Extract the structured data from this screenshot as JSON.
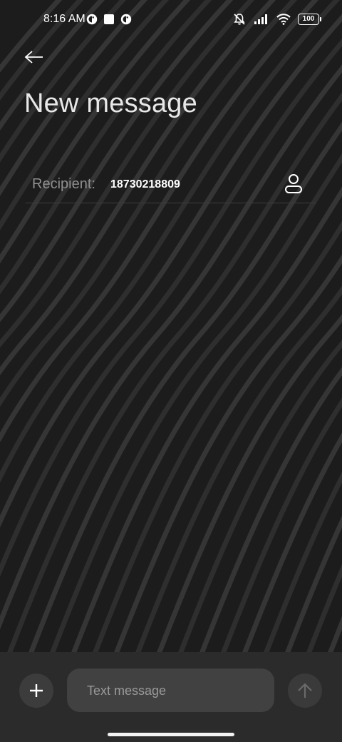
{
  "status_bar": {
    "time": "8:16 AM",
    "battery": "100",
    "left_icons": [
      "app-notification-icon",
      "square-notification-icon",
      "app-notification-icon"
    ],
    "right_icons": [
      "mute-icon",
      "signal-icon",
      "wifi-icon",
      "battery-icon"
    ]
  },
  "header": {
    "back_icon": "back-arrow-icon",
    "title": "New message"
  },
  "recipient": {
    "label": "Recipient:",
    "value": "18730218809",
    "contact_icon": "person-icon"
  },
  "composer": {
    "add_icon": "plus-icon",
    "placeholder": "Text message",
    "send_icon": "arrow-up-icon"
  },
  "colors": {
    "background": "#1c1c1c",
    "composer_bg": "#2b2b2b",
    "field_bg": "#414141",
    "muted_text": "#8f8f8f"
  }
}
